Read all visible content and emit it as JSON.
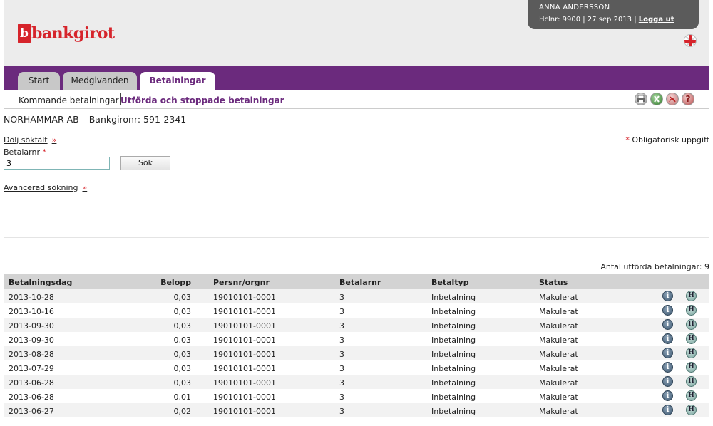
{
  "brand": {
    "logo_mark": "b",
    "logo_text": "bankgirot",
    "color": "#d6242b"
  },
  "user": {
    "name": "ANNA ANDERSSON",
    "info": "Hclnr: 9900 | 27 sep 2013 |",
    "logout_label": "Logga ut"
  },
  "language_icon": "uk-flag-icon",
  "nav": {
    "accent": "#6b2a7d",
    "tabs": [
      {
        "label": "Start",
        "active": false
      },
      {
        "label": "Medgivanden",
        "active": false
      },
      {
        "label": "Betalningar",
        "active": true
      }
    ]
  },
  "subnav": {
    "items": [
      {
        "label": "Kommande betalningar",
        "active": false
      },
      {
        "label": "Utförda och stoppade betalningar",
        "active": true
      }
    ],
    "tools": [
      "print-icon",
      "excel-icon",
      "pdf-icon",
      "help-icon"
    ]
  },
  "company": {
    "name": "NORHAMMAR AB",
    "bankgiro": "Bankgironr: 591-2341"
  },
  "search": {
    "hide_fields_label": "Dölj sökfält",
    "arrow": "»",
    "mandatory_marker": "*",
    "mandatory_text": "Obligatorisk uppgift",
    "payer_label": "Betalarnr",
    "payer_value": "3",
    "search_button": "Sök",
    "advanced_label": "Avancerad sökning"
  },
  "results": {
    "count_text": "Antal utförda betalningar: 9",
    "columns": [
      "Betalningsdag",
      "Belopp",
      "Persnr/orgnr",
      "Betalarnr",
      "Betaltyp",
      "Status"
    ],
    "rows": [
      {
        "date": "2013-10-28",
        "amount": "0,03",
        "persnr": "19010101-0001",
        "payer": "3",
        "type": "Inbetalning",
        "status": "Makulerat"
      },
      {
        "date": "2013-10-16",
        "amount": "0,03",
        "persnr": "19010101-0001",
        "payer": "3",
        "type": "Inbetalning",
        "status": "Makulerat"
      },
      {
        "date": "2013-09-30",
        "amount": "0,03",
        "persnr": "19010101-0001",
        "payer": "3",
        "type": "Inbetalning",
        "status": "Makulerat"
      },
      {
        "date": "2013-09-30",
        "amount": "0,03",
        "persnr": "19010101-0001",
        "payer": "3",
        "type": "Inbetalning",
        "status": "Makulerat"
      },
      {
        "date": "2013-08-28",
        "amount": "0,03",
        "persnr": "19010101-0001",
        "payer": "3",
        "type": "Inbetalning",
        "status": "Makulerat"
      },
      {
        "date": "2013-07-29",
        "amount": "0,03",
        "persnr": "19010101-0001",
        "payer": "3",
        "type": "Inbetalning",
        "status": "Makulerat"
      },
      {
        "date": "2013-06-28",
        "amount": "0,03",
        "persnr": "19010101-0001",
        "payer": "3",
        "type": "Inbetalning",
        "status": "Makulerat"
      },
      {
        "date": "2013-06-28",
        "amount": "0,01",
        "persnr": "19010101-0001",
        "payer": "3",
        "type": "Inbetalning",
        "status": "Makulerat"
      },
      {
        "date": "2013-06-27",
        "amount": "0,02",
        "persnr": "19010101-0001",
        "payer": "3",
        "type": "Inbetalning",
        "status": "Makulerat"
      }
    ],
    "row_icons": [
      "info-icon",
      "history-icon"
    ]
  }
}
